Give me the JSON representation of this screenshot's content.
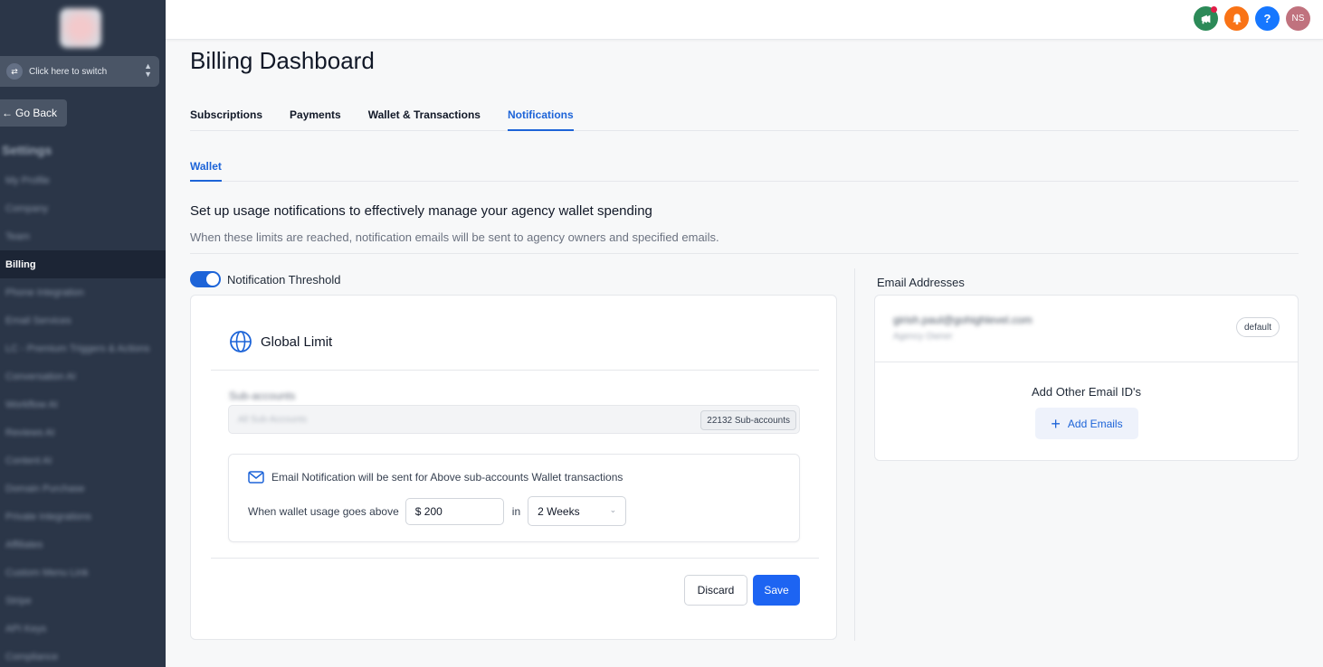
{
  "sidebar": {
    "switcher_label": "Click here to switch",
    "go_back": "Go Back",
    "section_heading": "Settings",
    "items": [
      {
        "label": "My Profile",
        "active": false
      },
      {
        "label": "Company",
        "active": false
      },
      {
        "label": "Team",
        "active": false
      },
      {
        "label": "Billing",
        "active": true
      },
      {
        "label": "Phone Integration",
        "active": false
      },
      {
        "label": "Email Services",
        "active": false
      },
      {
        "label": "LC - Premium Triggers & Actions",
        "active": false
      },
      {
        "label": "Conversation AI",
        "active": false
      },
      {
        "label": "Workflow AI",
        "active": false
      },
      {
        "label": "Reviews AI",
        "active": false
      },
      {
        "label": "Content AI",
        "active": false
      },
      {
        "label": "Domain Purchase",
        "active": false
      },
      {
        "label": "Private Integrations",
        "active": false
      },
      {
        "label": "Affiliates",
        "active": false
      },
      {
        "label": "Custom Menu Link",
        "active": false
      },
      {
        "label": "Stripe",
        "active": false
      },
      {
        "label": "API Keys",
        "active": false
      },
      {
        "label": "Compliance",
        "active": false
      }
    ]
  },
  "topbar": {
    "user_initials": "NS",
    "help_glyph": "?",
    "icons": [
      "megaphone-icon",
      "bell-icon",
      "help-icon",
      "avatar"
    ]
  },
  "page": {
    "title": "Billing Dashboard",
    "tabs": [
      {
        "label": "Subscriptions",
        "active": false
      },
      {
        "label": "Payments",
        "active": false
      },
      {
        "label": "Wallet & Transactions",
        "active": false
      },
      {
        "label": "Notifications",
        "active": true
      }
    ],
    "subtab": "Wallet",
    "section_title": "Set up usage notifications to effectively manage your agency wallet spending",
    "section_desc": "When these limits are reached, notification emails will be sent to agency owners and specified emails."
  },
  "threshold": {
    "toggle_label": "Notification Threshold",
    "enabled": true
  },
  "global_limit": {
    "title": "Global Limit",
    "subaccounts_label": "Sub-accounts",
    "subaccounts_placeholder": "All Sub-Accounts",
    "subaccounts_badge": "22132 Sub-accounts",
    "notice": "Email Notification will be sent for Above sub-accounts Wallet transactions",
    "usage_prefix": "When wallet usage goes above",
    "amount": "$ 200",
    "in_label": "in",
    "period": "2 Weeks",
    "discard": "Discard",
    "save": "Save"
  },
  "emails": {
    "title": "Email Addresses",
    "entries": [
      {
        "address": "girish.paul@gohighlevel.com",
        "role": "Agency Owner",
        "badge": "default"
      }
    ],
    "add_other_label": "Add Other Email ID's",
    "add_button": "Add Emails"
  },
  "colors": {
    "sidebar_bg": "#2b3648",
    "accent": "#1d64d8",
    "save_button": "#1d64f2"
  }
}
